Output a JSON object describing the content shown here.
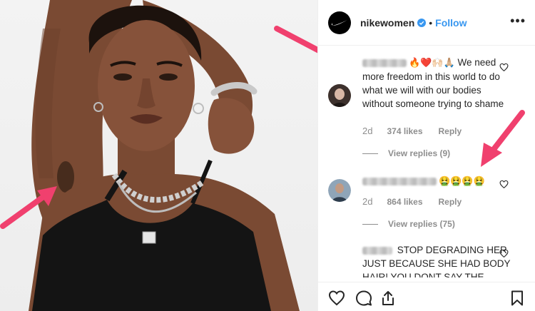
{
  "post": {
    "username": "nikewomen",
    "dot": "•",
    "follow_label": "Follow",
    "more_label": "•••"
  },
  "comments": [
    {
      "emojis": "🔥❤️🙌🏻🙏🏼",
      "text": "We need more freedom in this world to do what we will with our bodies without someone trying to shame",
      "time": "2d",
      "likes": "374 likes",
      "reply": "Reply",
      "view_replies": "View replies (9)"
    },
    {
      "emojis": "🤮🤮🤮🤮",
      "text": "",
      "time": "2d",
      "likes": "864 likes",
      "reply": "Reply",
      "view_replies": "View replies (75)"
    },
    {
      "emojis": "",
      "text": "STOP DEGRADING HER JUST BECAUSE SHE HAD BODY HAIR! YOU DONT SAY THE"
    }
  ],
  "colors": {
    "arrow": "#f0406e",
    "follow": "#3897f0",
    "meta": "#8e8e8e"
  }
}
